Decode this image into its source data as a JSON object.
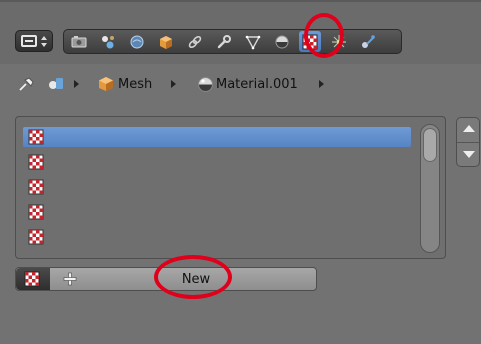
{
  "header": {
    "editor_type_icon": "properties-editor-icon",
    "tabs": [
      {
        "name": "render-icon"
      },
      {
        "name": "scene-icon"
      },
      {
        "name": "world-icon"
      },
      {
        "name": "object-icon"
      },
      {
        "name": "constraints-icon"
      },
      {
        "name": "modifiers-icon"
      },
      {
        "name": "data-icon"
      },
      {
        "name": "material-icon"
      },
      {
        "name": "texture-icon",
        "active": true
      },
      {
        "name": "particles-icon"
      },
      {
        "name": "physics-icon"
      }
    ]
  },
  "breadcrumb": {
    "pin_icon": "pin-icon",
    "items": [
      {
        "icon": "object-data-icon",
        "label": ""
      },
      {
        "icon": "mesh-icon",
        "label": "Mesh"
      },
      {
        "icon": "material-sphere-icon",
        "label": "Material.001"
      }
    ]
  },
  "texture_slots": {
    "rows": [
      {
        "icon": "checker-texture-icon",
        "selected": true
      },
      {
        "icon": "checker-texture-icon",
        "selected": false
      },
      {
        "icon": "checker-texture-icon",
        "selected": false
      },
      {
        "icon": "checker-texture-icon",
        "selected": false
      },
      {
        "icon": "checker-texture-icon",
        "selected": false
      }
    ]
  },
  "footer": {
    "browse_icon": "checker-texture-icon",
    "add_icon": "plus-icon",
    "new_label": "New"
  },
  "annotations": {
    "highlight_color": "#e0001b"
  }
}
